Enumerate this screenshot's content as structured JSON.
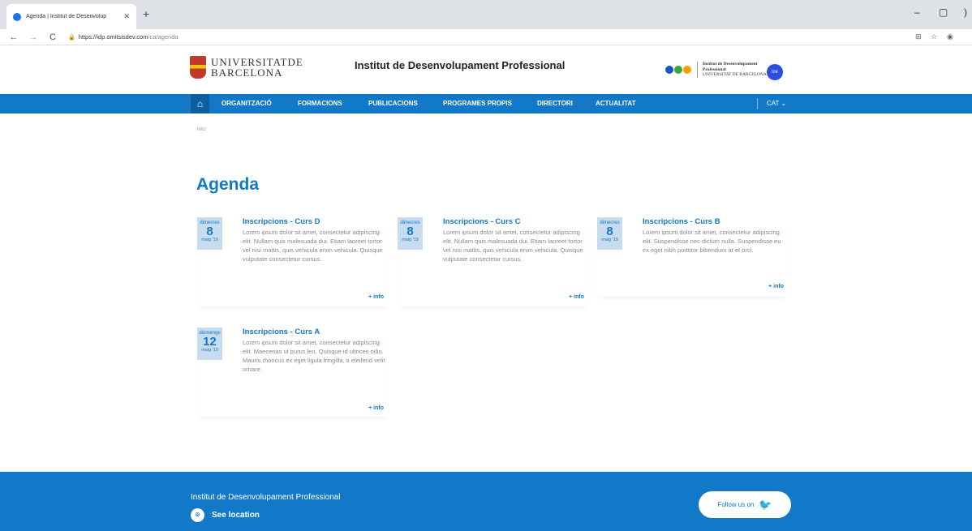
{
  "browser": {
    "tab_title": "Agenda | Institut de Desenvolup",
    "url_host": "https://idp.omitsisdev.com",
    "url_path": "/ca/agenda"
  },
  "header": {
    "ub_line1": "UNIVERSITATDE",
    "ub_line2": "BARCELONA",
    "title": "Institut de Desenvolupament Professional",
    "idp_line1": "Institut de Desenvolupament",
    "idp_line2": "Professional",
    "idp_line3": "UNIVERSITAT DE BARCELONA",
    "ice_badge": "ice"
  },
  "nav": {
    "items": [
      "ORGANITZACIÓ",
      "FORMACIONS",
      "PUBLICACIONS",
      "PROGRAMES PROPIS",
      "DIRECTORI",
      "ACTUALITAT"
    ],
    "lang": "CAT ⌄"
  },
  "breadcrumb": "Inici",
  "page_title": "Agenda",
  "events": [
    {
      "dow": "dimecres",
      "day": "8",
      "month": "maig '19",
      "title": "Inscripcions - Curs D",
      "body": "Lorem ipsum dolor sit amet, consectetur adipiscing elit. Nullam quis malesuada dui. Etiam laoreet tortor vel nisi mattis, quis vehicula enim vehicula. Quisque vulputate consectetur cursus.",
      "more": "+ info"
    },
    {
      "dow": "dimecres",
      "day": "8",
      "month": "maig '19",
      "title": "Inscripcions - Curs C",
      "body": "Lorem ipsum dolor sit amet, consectetur adipiscing elit. Nullam quis malesuada dui. Etiam laoreet tortor vel nisi mattis, quis vehicula enim vehicula. Quisque vulputate consectetur cursus.",
      "more": "+ info"
    },
    {
      "dow": "dimecres",
      "day": "8",
      "month": "maig '19",
      "title": "Inscripcions - Curs B",
      "body": "Lorem ipsum dolor sit amet, consectetur adipiscing elit. Suspendisse nec dictum nulla. Suspendisse eu ex eget nibh porttitor bibendum at et orci.",
      "more": "+ info"
    },
    {
      "dow": "diumenge",
      "day": "12",
      "month": "maig '19",
      "title": "Inscripcions - Curs A",
      "body": "Lorem ipsum dolor sit amet, consectetur adipiscing elit. Maecenas ut purus leo. Quisque id ultrices odio. Mauris rhoncus ex eget ligula fringilla, a eleifend velit ornare.",
      "more": "+ info"
    }
  ],
  "footer": {
    "title": "Institut de Desenvolupament Professional",
    "location": "See location",
    "follow": "Follow us on"
  },
  "colors": {
    "brand_blue": "#1279c8",
    "date_bg": "#c7dcee"
  },
  "icons": [
    "home-icon",
    "location-pin-icon",
    "twitter-bird-icon",
    "lock-icon"
  ]
}
